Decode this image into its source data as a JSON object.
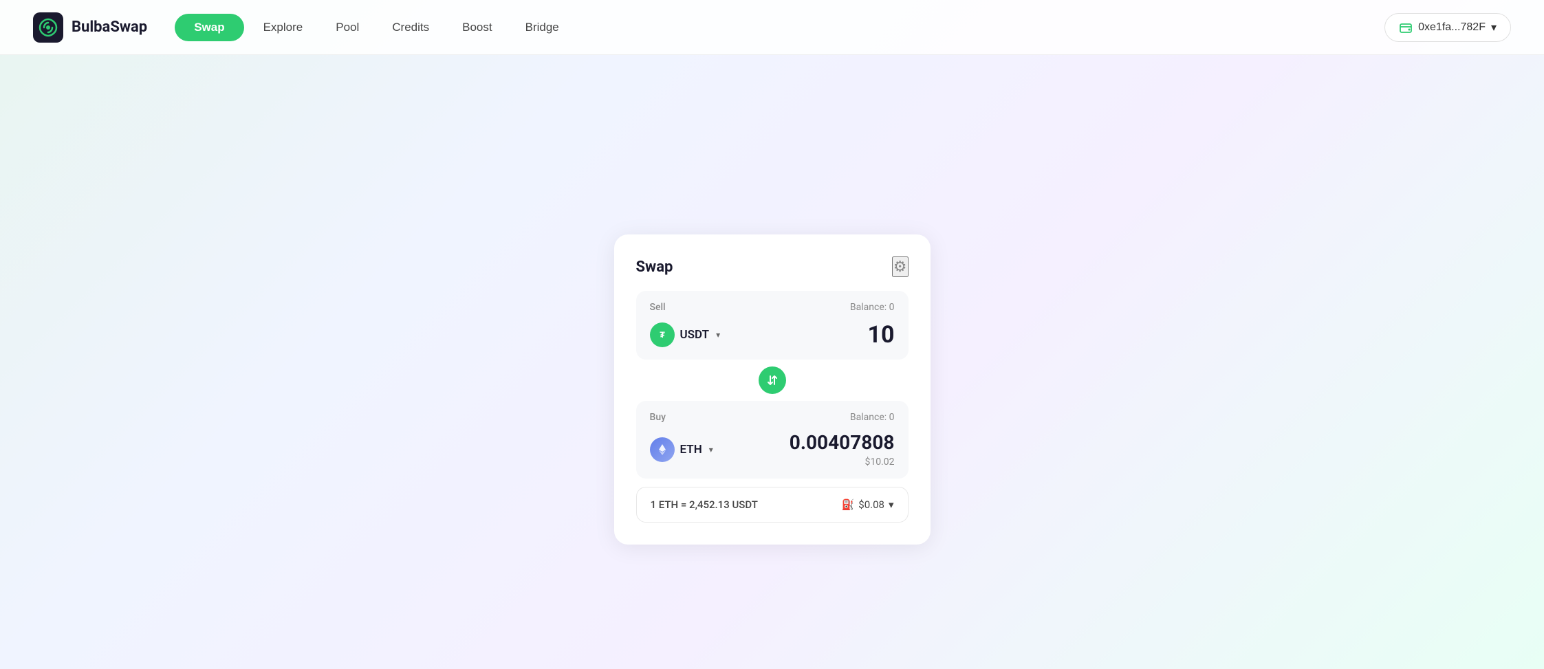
{
  "app": {
    "name": "BulbaSwap"
  },
  "navbar": {
    "logo_text": "BulbaSwap",
    "links": [
      {
        "label": "Swap",
        "active": true
      },
      {
        "label": "Explore",
        "active": false
      },
      {
        "label": "Pool",
        "active": false
      },
      {
        "label": "Credits",
        "active": false
      },
      {
        "label": "Boost",
        "active": false
      },
      {
        "label": "Bridge",
        "active": false
      }
    ],
    "wallet": {
      "address": "0xe1fa...782F",
      "chevron": "▾"
    }
  },
  "swap_card": {
    "title": "Swap",
    "settings_label": "⚙",
    "sell": {
      "label": "Sell",
      "balance": "Balance: 0",
      "token_symbol": "USDT",
      "token_chevron": "▾",
      "amount": "10"
    },
    "buy": {
      "label": "Buy",
      "balance": "Balance: 0",
      "token_symbol": "ETH",
      "token_chevron": "▾",
      "amount": "0.00407808",
      "usd_value": "$10.02"
    },
    "swap_direction_icon": "⇅",
    "rate": {
      "text": "1 ETH = 2,452.13 USDT",
      "gas_label": "$0.08",
      "gas_icon": "⛽",
      "chevron": "▾"
    }
  }
}
